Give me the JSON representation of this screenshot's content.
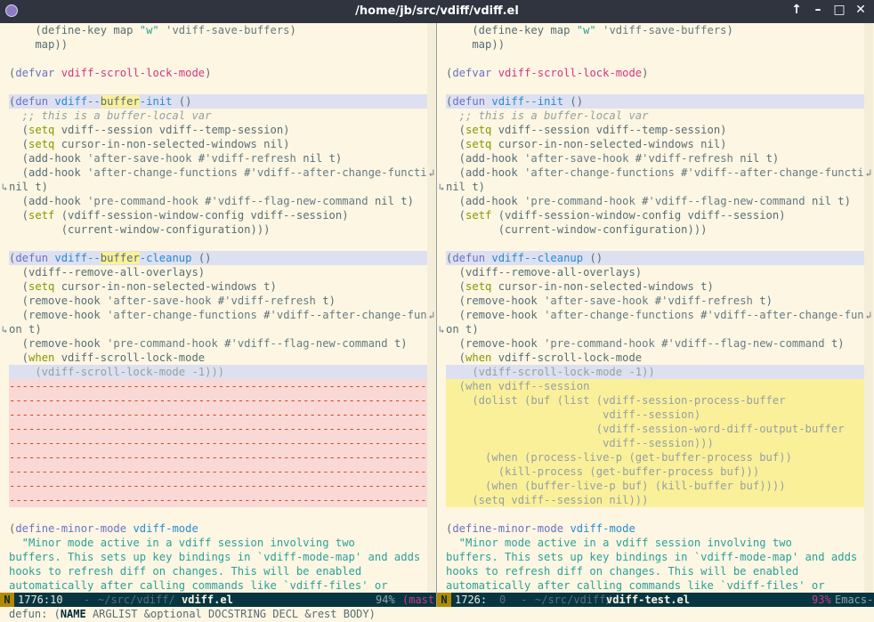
{
  "window": {
    "title": "/home/jb/src/vdiff/vdiff.el",
    "icons": [
      "emacs-icon",
      "maximize-up-arrow-icon",
      "minimize-icon",
      "maximize-icon",
      "close-icon"
    ]
  },
  "left_pane": {
    "lines": [
      "    (define-key map \"w\" 'vdiff-save-buffers)",
      "    map))",
      "",
      "(defvar vdiff-scroll-lock-mode)",
      "",
      "(defun vdiff--buffer-init ()",
      "  ;; this is a buffer-local var",
      "  (setq vdiff--session vdiff--temp-session)",
      "  (setq cursor-in-non-selected-windows nil)",
      "  (add-hook 'after-save-hook #'vdiff-refresh nil t)",
      "  (add-hook 'after-change-functions #'vdiff--after-change-function",
      "nil t)",
      "  (add-hook 'pre-command-hook #'vdiff--flag-new-command nil t)",
      "  (setf (vdiff-session-window-config vdiff--session)",
      "        (current-window-configuration)))",
      "",
      "(defun vdiff--buffer-cleanup ()",
      "  (vdiff--remove-all-overlays)",
      "  (setq cursor-in-non-selected-windows t)",
      "  (remove-hook 'after-save-hook #'vdiff-refresh t)",
      "  (remove-hook 'after-change-functions #'vdiff--after-change-functi",
      "on t)",
      "  (remove-hook 'pre-command-hook #'vdiff--flag-new-command t)",
      "  (when vdiff-scroll-lock-mode",
      "    (vdiff-scroll-lock-mode -1)))",
      "------------------------------------------------------------------",
      "------------------------------------------------------------------",
      "------------------------------------------------------------------",
      "------------------------------------------------------------------",
      "------------------------------------------------------------------",
      "------------------------------------------------------------------",
      "------------------------------------------------------------------",
      "------------------------------------------------------------------",
      "------------------------------------------------------------------",
      "",
      "(define-minor-mode vdiff-mode",
      "  \"Minor mode active in a vdiff session involving two",
      "buffers. This sets up key bindings in `vdiff-mode-map' and adds",
      "hooks to refresh diff on changes. This will be enabled",
      "automatically after calling commands like `vdiff-files' or"
    ]
  },
  "right_pane": {
    "lines": [
      "    (define-key map \"w\" 'vdiff-save-buffers)",
      "    map))",
      "",
      "(defvar vdiff-scroll-lock-mode)",
      "",
      "(defun vdiff--init ()",
      "  ;; this is a buffer-local var",
      "  (setq vdiff--session vdiff--temp-session)",
      "  (setq cursor-in-non-selected-windows nil)",
      "  (add-hook 'after-save-hook #'vdiff-refresh nil t)",
      "  (add-hook 'after-change-functions #'vdiff--after-change-function",
      "nil t)",
      "  (add-hook 'pre-command-hook #'vdiff--flag-new-command nil t)",
      "  (setf (vdiff-session-window-config vdiff--session)",
      "        (current-window-configuration)))",
      "",
      "(defun vdiff--cleanup ()",
      "  (vdiff--remove-all-overlays)",
      "  (setq cursor-in-non-selected-windows t)",
      "  (remove-hook 'after-save-hook #'vdiff-refresh t)",
      "  (remove-hook 'after-change-functions #'vdiff--after-change-functi",
      "on t)",
      "  (remove-hook 'pre-command-hook #'vdiff--flag-new-command t)",
      "  (when vdiff-scroll-lock-mode",
      "    (vdiff-scroll-lock-mode -1))",
      "  (when vdiff--session",
      "    (dolist (buf (list (vdiff-session-process-buffer",
      "                        vdiff--session)",
      "                       (vdiff-session-word-diff-output-buffer",
      "                        vdiff--session)))",
      "      (when (process-live-p (get-buffer-process buf))",
      "        (kill-process (get-buffer-process buf)))",
      "      (when (buffer-live-p buf) (kill-buffer buf))))",
      "    (setq vdiff--session nil)))",
      "",
      "(define-minor-mode vdiff-mode",
      "  \"Minor mode active in a vdiff session involving two",
      "buffers. This sets up key bindings in `vdiff-mode-map' and adds",
      "hooks to refresh diff on changes. This will be enabled",
      "automatically after calling commands like `vdiff-files' or"
    ]
  },
  "modeline_left": {
    "state": "N",
    "position": "1776:10",
    "separator": "-",
    "path": "~/src/vdiff/",
    "buffer": "vdiff.el",
    "percent": "94%",
    "mode": "(mast"
  },
  "modeline_right": {
    "state": "N",
    "position": "1726:",
    "col": "0",
    "separator": "-",
    "path": "~/src/vdiff/",
    "buffer": "vdiff-test.el",
    "percent": "93%",
    "mode": "Emacs-"
  },
  "echo_area": {
    "prefix": "defun:",
    "signature_open": "(",
    "signature_name": "NAME",
    "signature_rest": " ARGLIST &optional DOCSTRING DECL &rest BODY)"
  },
  "colors": {
    "background": "#fdf6e3",
    "titlebar": "#2f343f",
    "diff_change": "#dde0f0",
    "diff_delete": "#f9d8d5",
    "diff_add": "#fbf09a",
    "modeline": "#073642",
    "evil_state": "#b58900"
  }
}
